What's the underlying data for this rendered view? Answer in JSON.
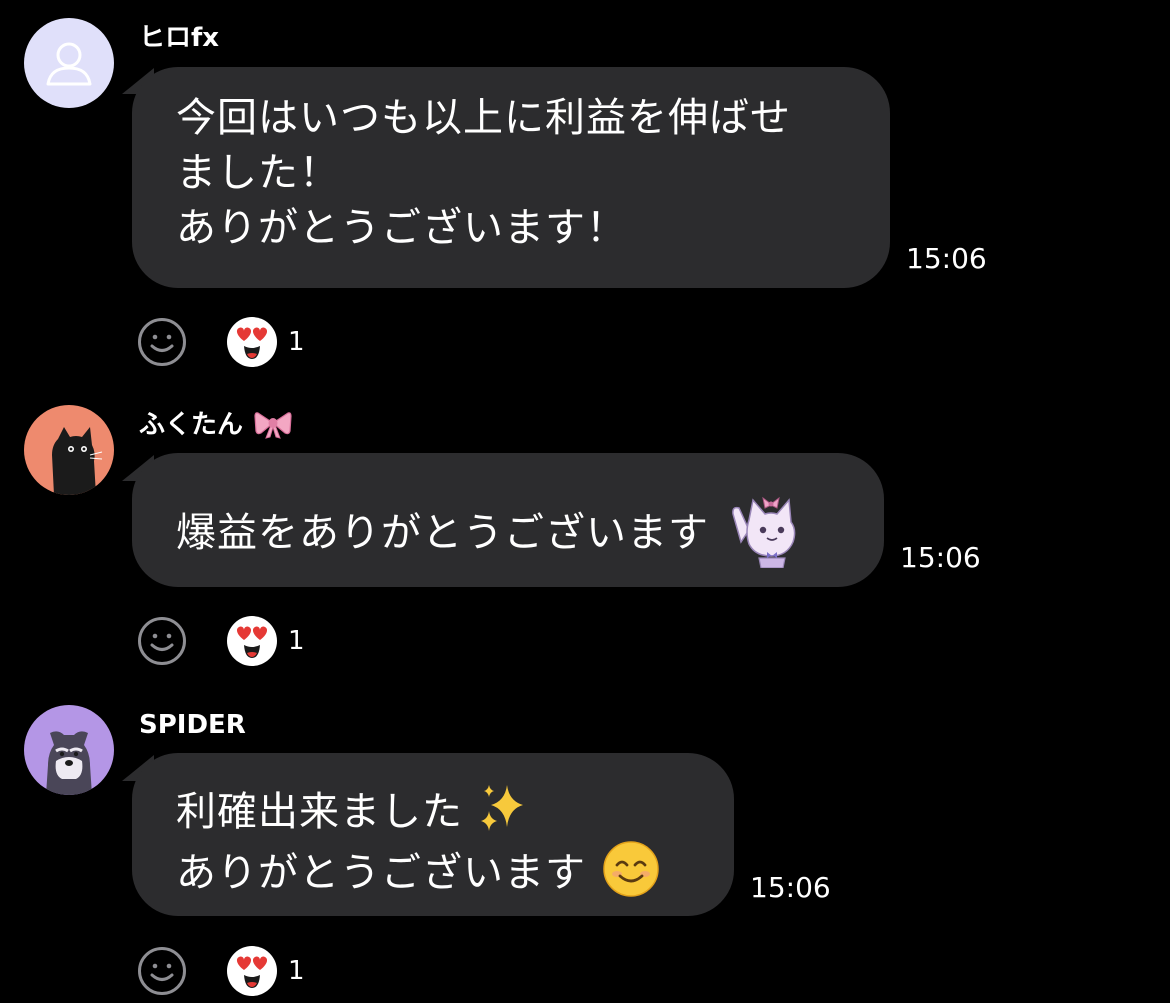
{
  "messages": [
    {
      "sender": "ヒロfx",
      "lines": [
        "今回はいつも以上に利益を伸ばせ",
        "ました！",
        "ありがとうございます！"
      ],
      "time": "15:06",
      "reaction_count": "1"
    },
    {
      "sender": "ふくたん",
      "lines": [
        "爆益をありがとうございます"
      ],
      "time": "15:06",
      "reaction_count": "1"
    },
    {
      "sender": "SPIDER",
      "lines": [
        "利確出来ました",
        "ありがとうございます"
      ],
      "time": "15:06",
      "reaction_count": "1"
    }
  ],
  "colors": {
    "background": "#000000",
    "bubble": "#2c2c2e",
    "avatar_default": "#e0e0fa",
    "avatar_cat": "#ee8a6e",
    "avatar_dog": "#b496e6",
    "heart": "#e53935"
  },
  "icons": {
    "default_avatar": "person-outline-icon",
    "add_reaction": "smiley-outline-icon",
    "reaction": "heart-eyes-face-icon"
  }
}
